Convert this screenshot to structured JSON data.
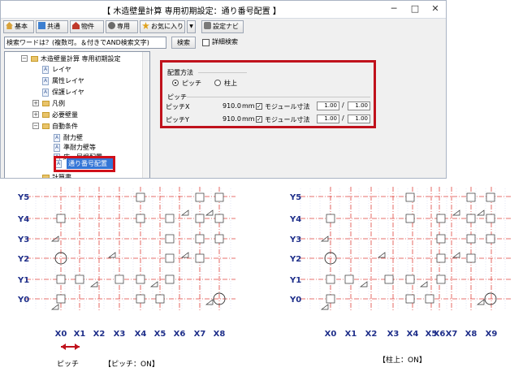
{
  "window": {
    "title": "【 木造壁量計算 専用初期設定：通り番号配置 】",
    "minimize": "─",
    "maximize": "□",
    "close": "✕"
  },
  "toolbar": {
    "buttons": [
      {
        "label": "基本",
        "icon": "house-icon"
      },
      {
        "label": "共通",
        "icon": "grid-icon"
      },
      {
        "label": "物件",
        "icon": "building-icon"
      },
      {
        "label": "専用",
        "icon": "user-icon"
      },
      {
        "label": "お気に入り",
        "icon": "star-icon"
      }
    ],
    "dropdown": "▼",
    "navi": "設定ナビ"
  },
  "search": {
    "placeholder": "検索ワードは？(複数可。＆付きでAND検索文字)",
    "button": "検索",
    "detail": "詳細検索"
  },
  "tree": {
    "root": "木造壁量計算 専用初期設定",
    "items": [
      "レイヤ",
      "属性レイヤ",
      "保護レイヤ",
      "凡例",
      "必要壁量",
      "自動条件"
    ],
    "subitems": [
      "耐力壁",
      "準耐力壁等",
      "床・屋根配置"
    ],
    "selected": "通り番号配置",
    "next_partial": "計算書"
  },
  "settings": {
    "placement_label": "配置方法",
    "option_pitch": "ピッチ",
    "option_column": "柱上",
    "pitch_group": "ピッチ",
    "pitch_x_label": "ピッチX",
    "pitch_y_label": "ピッチY",
    "pitch_x_value": "910.0",
    "pitch_y_value": "910.0",
    "unit": "mm",
    "modular_label": "モジュール寸法",
    "ratio_x": [
      "1.00",
      "1.00"
    ],
    "ratio_y": [
      "1.00",
      "1.00"
    ],
    "slash": "/"
  },
  "plans": {
    "y_labels": [
      "Y5",
      "Y4",
      "Y3",
      "Y2",
      "Y1",
      "Y0"
    ],
    "left_x_labels": [
      "X0",
      "X1",
      "X2",
      "X3",
      "X4",
      "X5",
      "X6",
      "X7",
      "X8"
    ],
    "right_x_labels": [
      "X0",
      "X1",
      "X2",
      "X3",
      "X4",
      "X5",
      "X6",
      "X7",
      "X8",
      "X9"
    ],
    "pitch_label": "ピッチ",
    "left_caption": "【ピッチ：ON】",
    "right_caption": "【柱上：ON】",
    "colors": {
      "grid": "#e0443e",
      "axis": "#cc2222",
      "label": "#1f2f8a",
      "dim": "#c0121c"
    }
  }
}
